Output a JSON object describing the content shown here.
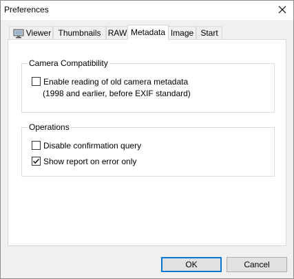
{
  "window": {
    "title": "Preferences"
  },
  "tabs": [
    {
      "label": "Viewer",
      "icon": "monitor-icon"
    },
    {
      "label": "Thumbnails"
    },
    {
      "label": "RAW"
    },
    {
      "label": "Metadata",
      "active": true
    },
    {
      "label": "Image"
    },
    {
      "label": "Start"
    }
  ],
  "camera_group": {
    "title": "Camera Compatibility",
    "enable_old_metadata": {
      "label": "Enable reading of old camera metadata",
      "checked": false
    },
    "note": "(1998 and earlier, before EXIF standard)"
  },
  "operations_group": {
    "title": "Operations",
    "disable_confirmation": {
      "label": "Disable confirmation query",
      "checked": false
    },
    "show_report": {
      "label": "Show report on error only",
      "checked": true
    }
  },
  "buttons": {
    "ok": "OK",
    "cancel": "Cancel"
  },
  "colors": {
    "default_button_border": "#0078d7",
    "panel_background": "#ffffff",
    "dialog_background": "#f0f0f0"
  }
}
